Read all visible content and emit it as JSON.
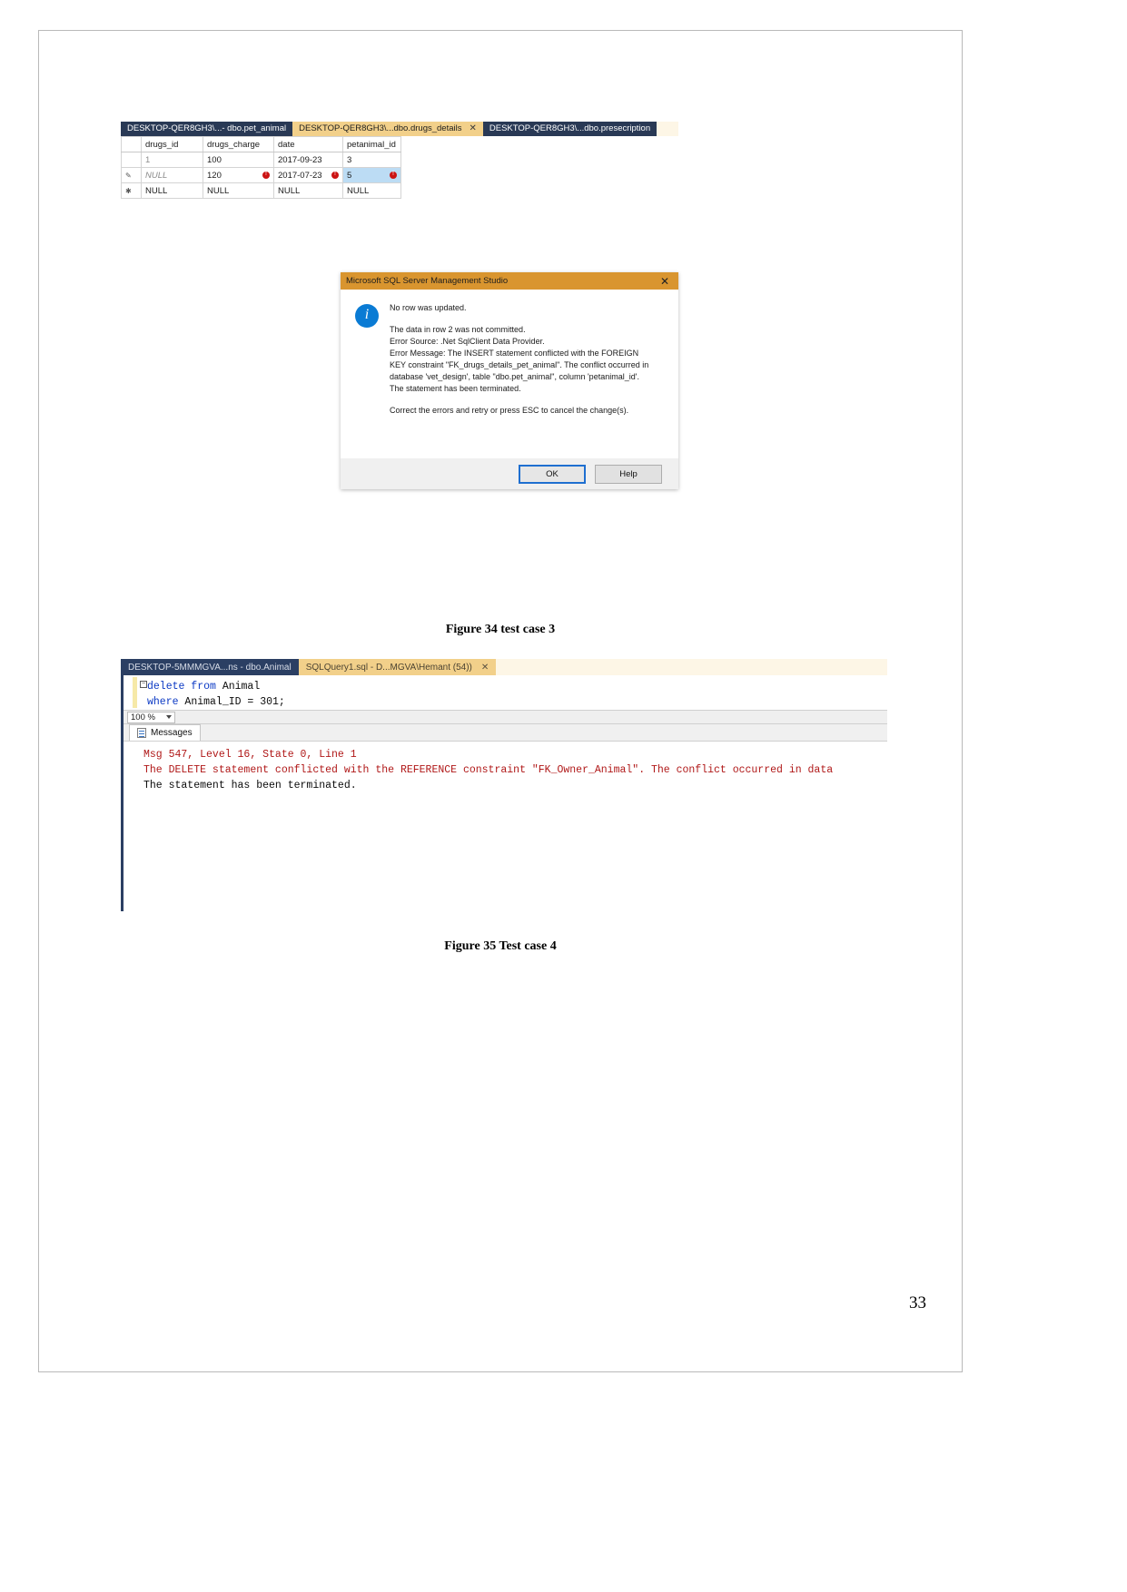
{
  "document": {
    "page_number": "33"
  },
  "figure34": {
    "caption": "Figure 34 test case 3",
    "tabs": [
      {
        "label": "DESKTOP-QER8GH3\\...- dbo.pet_animal",
        "active": false,
        "closable": false
      },
      {
        "label": "DESKTOP-QER8GH3\\...dbo.drugs_details",
        "active": true,
        "closable": true,
        "close_glyph": "✕"
      },
      {
        "label": "DESKTOP-QER8GH3\\...dbo.presecription",
        "active": false,
        "closable": false
      }
    ],
    "grid": {
      "columns": [
        "",
        "drugs_id",
        "drugs_charge",
        "date",
        "petanimal_id"
      ],
      "rows": [
        {
          "marker": "",
          "cells": [
            "1",
            "100",
            "2017-09-23",
            "3"
          ],
          "styles": [
            "gray",
            "",
            "",
            ""
          ],
          "errors": [
            false,
            false,
            false,
            false
          ],
          "selected": [
            false,
            false,
            false,
            false
          ]
        },
        {
          "marker": "✎",
          "cells": [
            "NULL",
            "120",
            "2017-07-23",
            "5"
          ],
          "styles": [
            "null",
            "",
            "",
            ""
          ],
          "errors": [
            false,
            true,
            true,
            true
          ],
          "selected": [
            false,
            false,
            false,
            true
          ]
        },
        {
          "marker": "✱",
          "cells": [
            "NULL",
            "NULL",
            "NULL",
            "NULL"
          ],
          "styles": [
            "",
            "",
            "",
            ""
          ],
          "errors": [
            false,
            false,
            false,
            false
          ],
          "selected": [
            false,
            false,
            false,
            false
          ]
        }
      ]
    },
    "dialog": {
      "title": "Microsoft SQL Server Management Studio",
      "close_glyph": "✕",
      "icon": "info-icon",
      "heading": "No row was updated.",
      "body_lines": [
        "The data in row 2 was not committed.",
        "Error Source: .Net SqlClient Data Provider.",
        "Error Message: The INSERT statement conflicted with the FOREIGN",
        "KEY constraint \"FK_drugs_details_pet_animal\". The conflict occurred in",
        "database 'vet_design', table \"dbo.pet_animal\", column 'petanimal_id'.",
        "The statement has been terminated."
      ],
      "footer_text": "Correct the errors and retry or press ESC to cancel the change(s).",
      "buttons": [
        {
          "label": "OK",
          "primary": true
        },
        {
          "label": "Help",
          "primary": false
        }
      ]
    }
  },
  "figure35": {
    "caption": "Figure 35 Test case 4",
    "tabs": [
      {
        "label": "DESKTOP-5MMMGVA...ns - dbo.Animal",
        "active": false
      },
      {
        "label": "SQLQuery1.sql - D...MGVA\\Hemant (54))",
        "active": true,
        "close_glyph": "✕"
      }
    ],
    "editor": {
      "fold_glyph": "−",
      "lines": [
        [
          {
            "t": "delete from",
            "kw": true
          },
          {
            "t": " Animal",
            "kw": false
          }
        ],
        [
          {
            "t": "where",
            "kw": true
          },
          {
            "t": " Animal_ID = 301;",
            "kw": false
          }
        ]
      ]
    },
    "zoom_bar": {
      "value": "100 %"
    },
    "messages_tab": {
      "label": "Messages",
      "icon": "messages-icon"
    },
    "messages": [
      {
        "text": "Msg 547, Level 16, State 0, Line 1",
        "color": "red"
      },
      {
        "text": "The DELETE statement conflicted with the REFERENCE constraint \"FK_Owner_Animal\". The conflict occurred in data",
        "color": "red"
      },
      {
        "text": "The statement has been terminated.",
        "color": "black"
      }
    ]
  }
}
